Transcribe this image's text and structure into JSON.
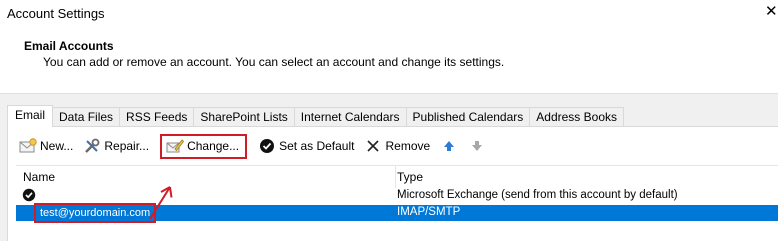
{
  "window": {
    "title": "Account Settings",
    "close_glyph": "✕"
  },
  "header": {
    "title": "Email Accounts",
    "subtitle": "You can add or remove an account. You can select an account and change its settings."
  },
  "tabs": [
    {
      "label": "Email",
      "active": true
    },
    {
      "label": "Data Files"
    },
    {
      "label": "RSS Feeds"
    },
    {
      "label": "SharePoint Lists"
    },
    {
      "label": "Internet Calendars"
    },
    {
      "label": "Published Calendars"
    },
    {
      "label": "Address Books"
    }
  ],
  "toolbar": {
    "new_label": "New...",
    "repair_label": "Repair...",
    "change_label": "Change...",
    "default_label": "Set as Default",
    "remove_label": "Remove"
  },
  "list": {
    "col_name": "Name",
    "col_type": "Type",
    "rows": [
      {
        "name": "",
        "type": "Microsoft Exchange (send from this account by default)",
        "default": true
      },
      {
        "name": "test@yourdomain.com",
        "type": "IMAP/SMTP",
        "selected": true
      }
    ]
  },
  "colors": {
    "highlight": "#d11b27",
    "selection": "#0078d7"
  }
}
